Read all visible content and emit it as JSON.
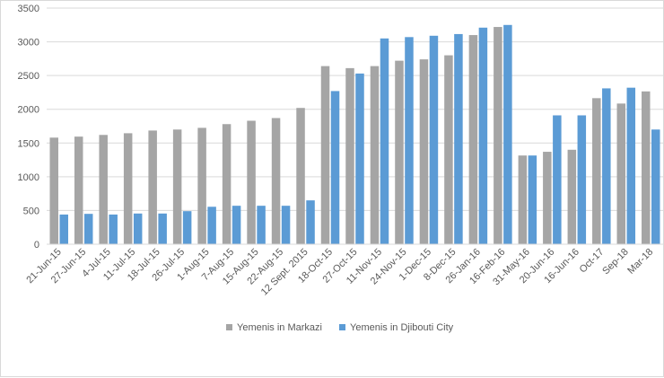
{
  "chart_data": {
    "type": "bar",
    "title": "",
    "xlabel": "",
    "ylabel": "",
    "ylim": [
      0,
      3500
    ],
    "yticks": [
      0,
      500,
      1000,
      1500,
      2000,
      2500,
      3000,
      3500
    ],
    "grid": true,
    "legend_position": "bottom",
    "categories": [
      "21-Jun-15",
      "27-Jun-15",
      "4-Jul-15",
      "11-Jul-15",
      "18-Jul-15",
      "26-Jul-15",
      "1-Aug-15",
      "7-Aug-15",
      "15-Aug-15",
      "22-Aug-15",
      "12 Sept. 2015",
      "18-Oct-15",
      "27-Oct-15",
      "11-Nov-15",
      "24-Nov-15",
      "1-Dec-15",
      "8-Dec-15",
      "26-Jan-16",
      "16-Feb-16",
      "31-May-16",
      "20-Jun-16",
      "16-Jun-16",
      "Oct-17",
      "Sep-18",
      "Mar-18"
    ],
    "series": [
      {
        "name": "Yemenis in Markazi",
        "color": "#a5a5a5",
        "values": [
          1580,
          1595,
          1620,
          1645,
          1685,
          1700,
          1725,
          1780,
          1830,
          1870,
          2020,
          2640,
          2610,
          2640,
          2720,
          2740,
          2800,
          3100,
          3220,
          1315,
          1370,
          1400,
          2165,
          2085,
          2265
        ]
      },
      {
        "name": "Yemenis in Djibouti City",
        "color": "#5b9bd5",
        "values": [
          440,
          450,
          440,
          455,
          455,
          490,
          555,
          570,
          570,
          570,
          650,
          2270,
          2530,
          3050,
          3070,
          3090,
          3115,
          3210,
          3250,
          1315,
          1910,
          1910,
          2310,
          2320,
          1700
        ]
      }
    ]
  }
}
